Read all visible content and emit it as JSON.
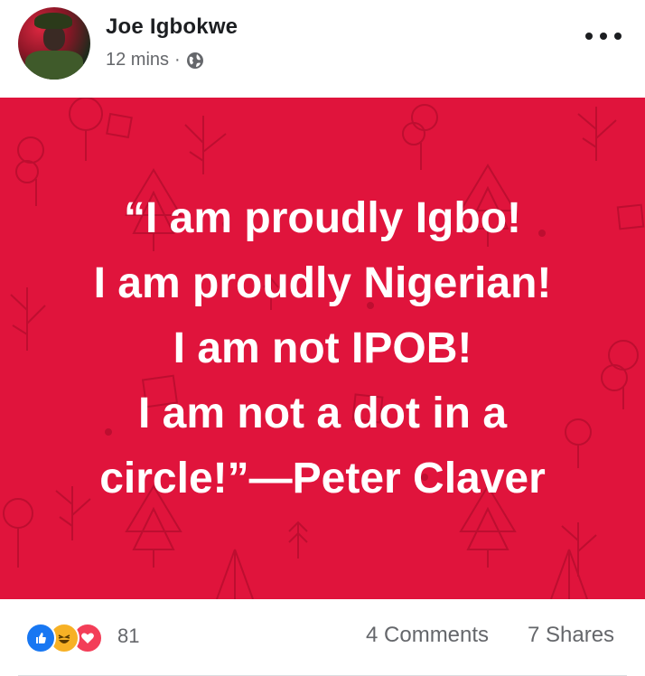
{
  "post": {
    "author": "Joe Igbokwe",
    "time": "12 mins",
    "separator": "·",
    "privacy_icon": "globe-icon",
    "more_icon": "more-options-icon"
  },
  "image": {
    "background_color": "#e0143c",
    "quote_lines": [
      "“I am proudly Igbo!",
      "I am proudly Nigerian!",
      "I am not IPOB!",
      "I am not a dot in a",
      "circle!”—Peter Claver"
    ]
  },
  "footer": {
    "reaction_icons": [
      "like-icon",
      "haha-icon",
      "love-icon"
    ],
    "reaction_count": "81",
    "comments": "4 Comments",
    "shares": "7 Shares"
  },
  "colors": {
    "like": "#1877f2",
    "haha": "#f7b125",
    "love": "#f33e58",
    "muted": "#65676b"
  }
}
